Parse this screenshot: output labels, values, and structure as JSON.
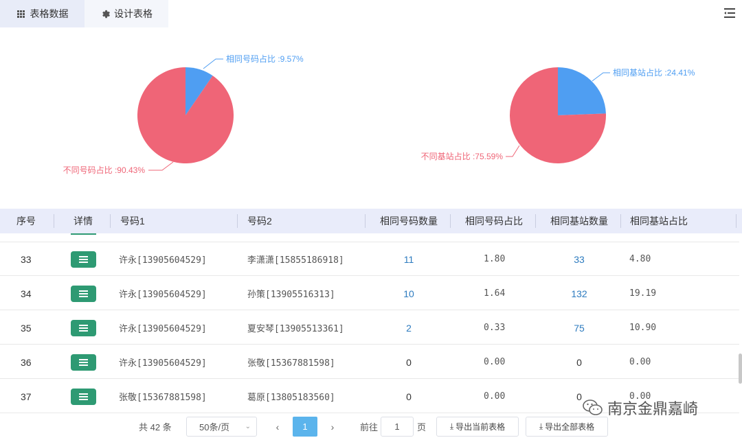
{
  "tabs": [
    {
      "label": "表格数据",
      "icon": "grid-icon",
      "active": true
    },
    {
      "label": "设计表格",
      "icon": "gear-icon",
      "active": false
    }
  ],
  "toolbar": {
    "menu_icon": "list-menu-icon"
  },
  "chart_data": [
    {
      "type": "pie",
      "slices": [
        {
          "label": "相同号码占比 :9.57%",
          "value": 9.57,
          "color": "#4f9ef2"
        },
        {
          "label": "不同号码占比 :90.43%",
          "value": 90.43,
          "color": "#ef6577"
        }
      ]
    },
    {
      "type": "pie",
      "slices": [
        {
          "label": "相同基站占比 :24.41%",
          "value": 24.41,
          "color": "#4f9ef2"
        },
        {
          "label": "不同基站占比 :75.59%",
          "value": 75.59,
          "color": "#ef6577"
        }
      ]
    }
  ],
  "table": {
    "headers": [
      "序号",
      "详情",
      "号码1",
      "号码2",
      "相同号码数量",
      "相同号码占比",
      "相同基站数量",
      "相同基站占比"
    ],
    "rows": [
      {
        "no": "33",
        "num1": "许永[13905604529]",
        "num2": "李潇潇[15855186918]",
        "same_num_count": "11",
        "same_num_ratio": "1.80",
        "same_bs_count": "33",
        "same_bs_ratio": "4.80"
      },
      {
        "no": "34",
        "num1": "许永[13905604529]",
        "num2": "孙策[13905516313]",
        "same_num_count": "10",
        "same_num_ratio": "1.64",
        "same_bs_count": "132",
        "same_bs_ratio": "19.19"
      },
      {
        "no": "35",
        "num1": "许永[13905604529]",
        "num2": "夏安琴[13905513361]",
        "same_num_count": "2",
        "same_num_ratio": "0.33",
        "same_bs_count": "75",
        "same_bs_ratio": "10.90"
      },
      {
        "no": "36",
        "num1": "许永[13905604529]",
        "num2": "张敬[15367881598]",
        "same_num_count": "0",
        "same_num_ratio": "0.00",
        "same_bs_count": "0",
        "same_bs_ratio": "0.00"
      },
      {
        "no": "37",
        "num1": "张敬[15367881598]",
        "num2": "葛原[13805183560]",
        "same_num_count": "0",
        "same_num_ratio": "0.00",
        "same_bs_count": "0",
        "same_bs_ratio": "0.00"
      }
    ]
  },
  "pager": {
    "total": "共 42 条",
    "page_size": "50条/页",
    "current_page": "1",
    "goto_label": "前往",
    "goto_value": "1",
    "page_unit": "页",
    "export_current": "导出当前表格",
    "export_all": "导出全部表格"
  },
  "watermark": {
    "text": "南京金鼎嘉崎",
    "icon": "wechat-icon"
  }
}
